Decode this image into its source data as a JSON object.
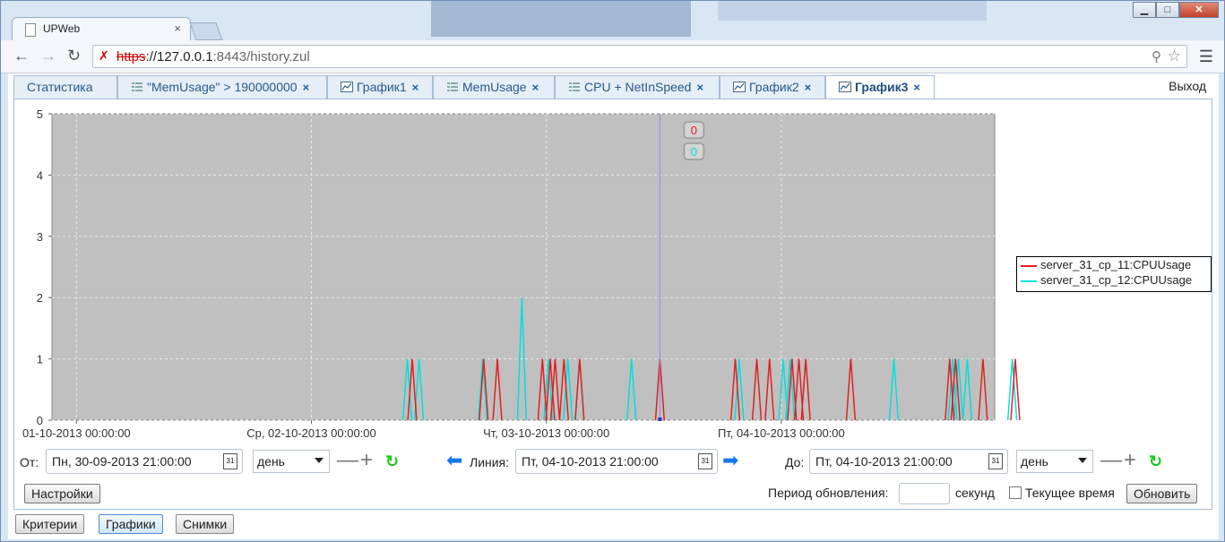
{
  "browser": {
    "tab_title": "UPWeb",
    "tab_close": "×",
    "url_proto": "https",
    "url_host": "://127.0.0.1",
    "url_port_path": ":8443/history.zul",
    "window_minimize": "▁",
    "window_maximize": "□",
    "window_close": "✕"
  },
  "app_tabs": [
    {
      "label": "Статистика",
      "closable": false,
      "icon": "none"
    },
    {
      "label": "\"MemUsage\" > 190000000",
      "closable": true,
      "icon": "table-icon"
    },
    {
      "label": "График1",
      "closable": true,
      "icon": "chart-icon"
    },
    {
      "label": "MemUsage",
      "closable": true,
      "icon": "table-icon"
    },
    {
      "label": "CPU + NetInSpeed",
      "closable": true,
      "icon": "table-icon"
    },
    {
      "label": "График2",
      "closable": true,
      "icon": "chart-icon"
    },
    {
      "label": "График3",
      "closable": true,
      "icon": "chart-icon",
      "active": true
    }
  ],
  "tab_close_glyph": "×",
  "exit_label": "Выход",
  "chart_data": {
    "type": "line",
    "ylim": [
      0,
      5
    ],
    "yticks": [
      "0",
      "1",
      "2",
      "3",
      "4",
      "5"
    ],
    "xtick_labels": [
      "01-10-2013 00:00:00",
      "Ср, 02-10-2013 00:00:00",
      "Чт, 03-10-2013 00:00:00",
      "Пт, 04-10-2013 00:00:00"
    ],
    "grid": true,
    "background": "#c0c0c0",
    "legend_position": "right",
    "cursor_values": [
      "0",
      "0"
    ],
    "series": [
      {
        "name": "server_31_cp_11:CPUUsage",
        "color": "#e02020",
        "spikes_hours": [
          34.3,
          41.6,
          43.0,
          47.6,
          48.4,
          48.9,
          49.8,
          51.4,
          59.6,
          67.3,
          69.5,
          70.8,
          73.1,
          73.8,
          74.5,
          79.1,
          89.2,
          89.8,
          92.6,
          95.9
        ],
        "spike_value": 1
      },
      {
        "name": "server_31_cp_12:CPUUsage",
        "color": "#00e0e0",
        "spikes_hours": [
          33.8,
          35.0,
          41.5,
          48.2,
          50.2,
          51.4,
          56.7,
          67.7,
          72.2,
          72.9,
          83.5,
          89.5,
          90.1,
          91.0,
          95.6
        ],
        "spike_value": 1,
        "big_spike_hour": 45.5,
        "big_spike_value": 2
      }
    ],
    "x_range_hours": [
      -2.5,
      93.8
    ]
  },
  "controls": {
    "from_label": "От:",
    "from_value": "Пн, 30-09-2013 21:00:00",
    "from_unit": "день",
    "line_label": "Линия:",
    "line_value": "Пт, 04-10-2013 21:00:00",
    "to_label": "До:",
    "to_value": "Пт, 04-10-2013 21:00:00",
    "to_unit": "день",
    "minus": "—",
    "plus": "+",
    "refresh": "↻",
    "calendar": "31",
    "settings_button": "Настройки",
    "period_label": "Период обновления:",
    "period_value": "",
    "seconds_label": "секунд",
    "current_time_label": "Текущее время",
    "update_button": "Обновить"
  },
  "bottom_tabs": [
    "Критерии",
    "Графики",
    "Снимки"
  ]
}
